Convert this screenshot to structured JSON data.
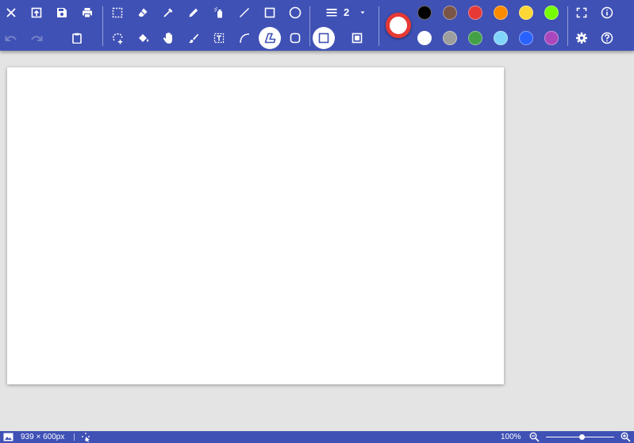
{
  "toolbar": {
    "stroke_width": "2"
  },
  "palette": {
    "main_fill": "#ffffff",
    "main_border": "#e53935",
    "colors": [
      "#000000",
      "#795548",
      "#e53935",
      "#fb8c00",
      "#fdd835",
      "#76ff03",
      "#ffffff",
      "#9e9e9e",
      "#43a047",
      "#81d4fa",
      "#2962ff",
      "#ab47bc"
    ]
  },
  "status": {
    "image_size": "939 × 600px",
    "zoom": "100%",
    "zoom_value": 1.0
  }
}
